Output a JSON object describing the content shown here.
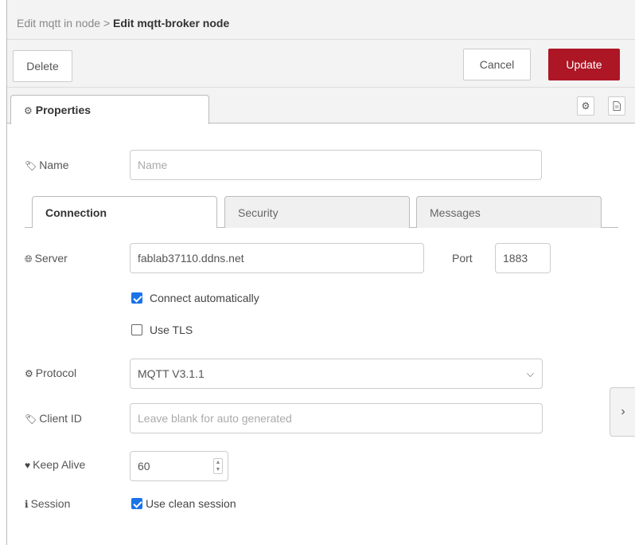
{
  "breadcrumb": {
    "parent": "Edit mqtt in node",
    "separator": " > ",
    "current": "Edit mqtt-broker node"
  },
  "toolbar": {
    "delete_label": "Delete",
    "cancel_label": "Cancel",
    "update_label": "Update"
  },
  "tabs": {
    "properties_label": "Properties"
  },
  "form": {
    "name": {
      "label": "Name",
      "value": "",
      "placeholder": "Name"
    },
    "inner_tabs": {
      "connection": "Connection",
      "security": "Security",
      "messages": "Messages"
    },
    "server": {
      "label": "Server",
      "value": "fablab37110.ddns.net"
    },
    "port": {
      "label": "Port",
      "value": "1883"
    },
    "connect_auto": {
      "label": "Connect automatically",
      "checked": true
    },
    "use_tls": {
      "label": "Use TLS",
      "checked": false
    },
    "protocol": {
      "label": "Protocol",
      "value": "MQTT V3.1.1"
    },
    "client_id": {
      "label": "Client ID",
      "value": "",
      "placeholder": "Leave blank for auto generated"
    },
    "keep_alive": {
      "label": "Keep Alive",
      "value": "60"
    },
    "session": {
      "label": "Session",
      "option_label": "Use clean session",
      "checked": true
    }
  },
  "icons": {
    "tag": "tag-icon",
    "globe": "globe-icon",
    "gear": "gear-icon",
    "heartbeat": "heartbeat-icon",
    "info": "info-icon",
    "chevron_right": "chevron-right-icon"
  },
  "colors": {
    "update_button": "#ad1625",
    "checkbox_checked": "#1a73e8"
  }
}
